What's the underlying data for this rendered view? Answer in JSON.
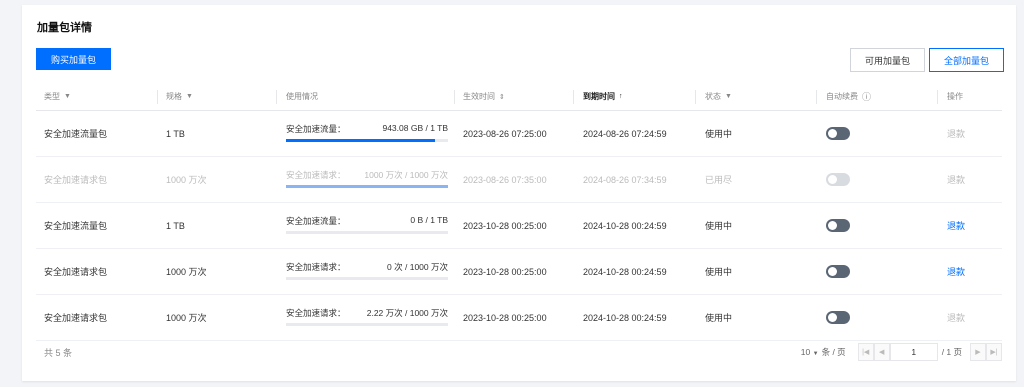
{
  "title": "加量包详情",
  "buy_button": "购买加量包",
  "filters": [
    "可用加量包",
    "全部加量包"
  ],
  "columns": {
    "type": "类型",
    "spec": "规格",
    "usage": "使用情况",
    "effective": "生效时间",
    "expire": "到期时间",
    "status": "状态",
    "auto_renew": "自动续费",
    "action": "操作"
  },
  "rows": [
    {
      "type": "安全加速流量包",
      "spec": "1 TB",
      "usage_label": "安全加速流量：",
      "usage_value": "943.08 GB / 1 TB",
      "usage_pct": 0.92,
      "effective": "2023-08-26 07:25:00",
      "expire": "2024-08-26 07:24:59",
      "status": "使用中",
      "action": "退款",
      "disabled": false,
      "action_enabled": false
    },
    {
      "type": "安全加速请求包",
      "spec": "1000 万次",
      "usage_label": "安全加速请求：",
      "usage_value": "1000 万次 / 1000 万次",
      "usage_pct": 1.0,
      "effective": "2023-08-26 07:35:00",
      "expire": "2024-08-26 07:34:59",
      "status": "已用尽",
      "action": "退款",
      "disabled": true,
      "action_enabled": false
    },
    {
      "type": "安全加速流量包",
      "spec": "1 TB",
      "usage_label": "安全加速流量：",
      "usage_value": "0 B / 1 TB",
      "usage_pct": 0,
      "effective": "2023-10-28 00:25:00",
      "expire": "2024-10-28 00:24:59",
      "status": "使用中",
      "action": "退款",
      "disabled": false,
      "action_enabled": true
    },
    {
      "type": "安全加速请求包",
      "spec": "1000 万次",
      "usage_label": "安全加速请求：",
      "usage_value": "0 次 / 1000 万次",
      "usage_pct": 0,
      "effective": "2023-10-28 00:25:00",
      "expire": "2024-10-28 00:24:59",
      "status": "使用中",
      "action": "退款",
      "disabled": false,
      "action_enabled": true
    },
    {
      "type": "安全加速请求包",
      "spec": "1000 万次",
      "usage_label": "安全加速请求：",
      "usage_value": "2.22 万次 / 1000 万次",
      "usage_pct": 0,
      "effective": "2023-10-28 00:25:00",
      "expire": "2024-10-28 00:24:59",
      "status": "使用中",
      "action": "退款",
      "disabled": false,
      "action_enabled": false
    }
  ],
  "footer": {
    "total": "共 5 条",
    "page_size": "10",
    "per_page": "条 / 页",
    "current_page": "1",
    "page_total": "/ 1 页"
  },
  "icons": {
    "filter": "filter-icon",
    "sort": "sort-icon",
    "info": "info-icon"
  },
  "colors": {
    "accent": "#006eff",
    "toggle_off": "#5b6675"
  }
}
